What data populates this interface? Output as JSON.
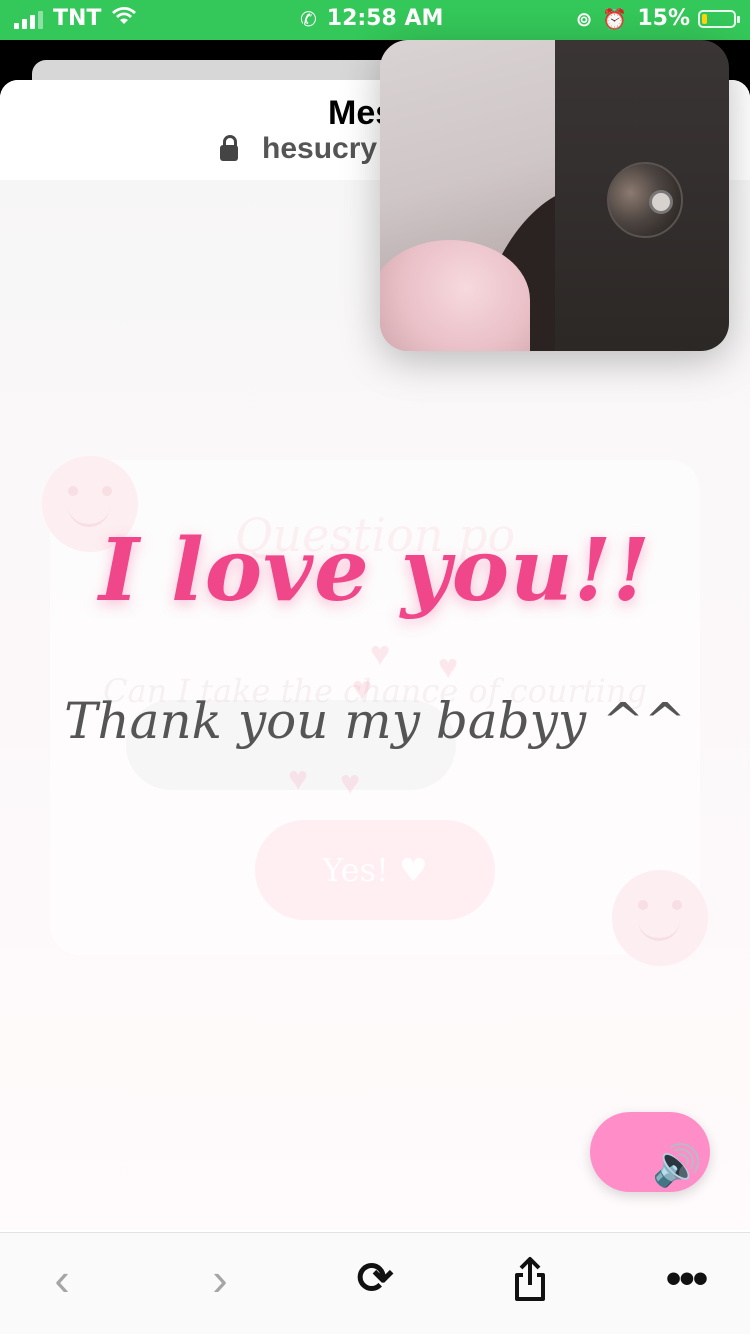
{
  "status_bar": {
    "carrier": "TNT",
    "time": "12:58 AM",
    "battery": "15%",
    "battery_level": 0.15
  },
  "browser": {
    "title": "Messe",
    "url": "hesucry"
  },
  "background_card": {
    "title": "Question po",
    "subtitle": "Can I take the chance of courting",
    "yes_label": "Yes!"
  },
  "main": {
    "headline": "I love you!!",
    "message": "Thank you my babyy ^^"
  },
  "sound_button": {
    "icon": "speaker-icon",
    "glyph": "🔊"
  },
  "toolbar": {
    "back_glyph": "‹",
    "forward_glyph": "›",
    "reload_glyph": "⟳",
    "more_glyph": "•••"
  },
  "colors": {
    "status_green": "#34c759",
    "headline_pink": "#f0468a",
    "sound_button_pink": "#ff8ec8"
  }
}
